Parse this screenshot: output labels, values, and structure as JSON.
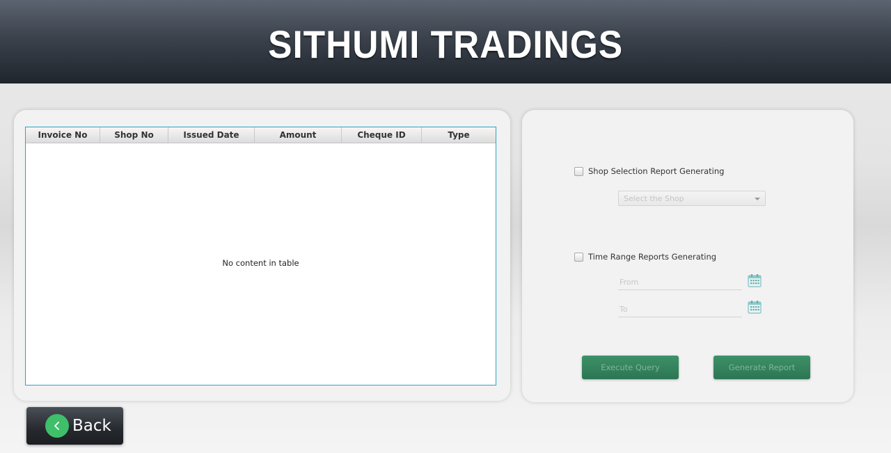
{
  "header": {
    "title": "SITHUMI TRADINGS"
  },
  "table": {
    "columns": [
      "Invoice No",
      "Shop No",
      "Issued Date",
      "Amount",
      "Cheque ID",
      "Type"
    ],
    "empty_message": "No content in table"
  },
  "filters": {
    "shop_check_label": "Shop Selection Report Generating",
    "shop_select_placeholder": "Select the Shop",
    "time_check_label": "Time Range Reports Generating",
    "from_placeholder": "From",
    "to_placeholder": "To"
  },
  "buttons": {
    "execute_label": "Execute Query",
    "generate_label": "Generate Report",
    "back_label": "Back"
  },
  "icons": {
    "calendar": "calendar-icon",
    "back": "chevron-left-icon",
    "dropdown": "chevron-down-icon"
  },
  "colors": {
    "header_dark": "#20252d",
    "table_border": "#2aa3c4",
    "button_green": "#3d9168",
    "back_icon_green": "#3fbf6a"
  }
}
